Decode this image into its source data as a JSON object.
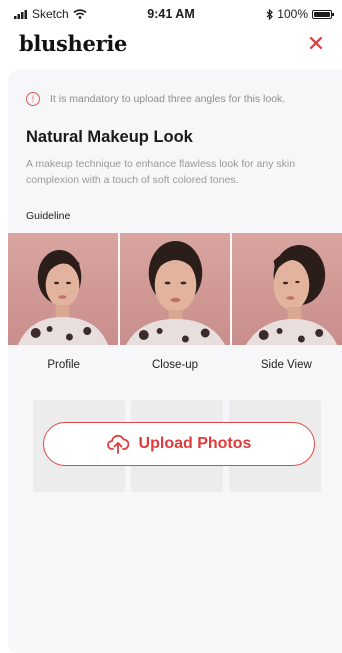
{
  "status_bar": {
    "carrier": "Sketch",
    "time": "9:41 AM",
    "battery": "100%"
  },
  "header": {
    "logo": "blusherie",
    "close_label": "✕"
  },
  "notice": {
    "text": "It is mandatory to upload three angles for this look."
  },
  "look": {
    "title": "Natural Makeup Look",
    "description": "A makeup technique to enhance flawless look for any skin complexion with a touch of soft colored tones."
  },
  "guideline": {
    "label": "Guideline",
    "captions": [
      "Profile",
      "Close-up",
      "Side View"
    ]
  },
  "upload": {
    "label": "Upload Photos"
  },
  "colors": {
    "accent": "#e03a3a",
    "background": "#f7f6f8",
    "photo_bg": "#d9a5a0"
  }
}
